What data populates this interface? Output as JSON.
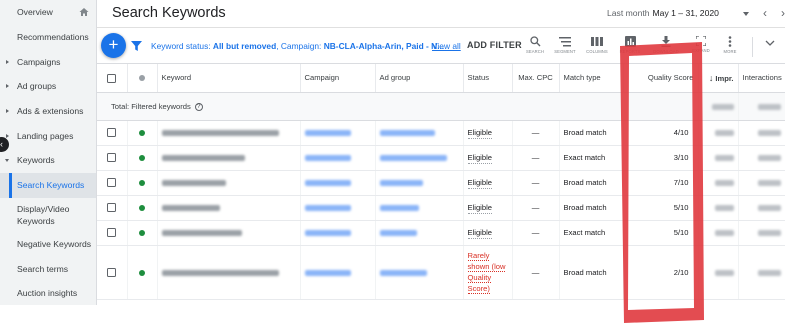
{
  "sidebar": {
    "items": [
      {
        "label": "Overview",
        "type": "top"
      },
      {
        "label": "Recommendations",
        "type": "top"
      },
      {
        "label": "Campaigns",
        "type": "caret"
      },
      {
        "label": "Ad groups",
        "type": "caret"
      },
      {
        "label": "Ads & extensions",
        "type": "caret"
      },
      {
        "label": "Landing pages",
        "type": "caret"
      },
      {
        "label": "Keywords",
        "type": "open"
      },
      {
        "label": "Search Keywords",
        "type": "active"
      },
      {
        "label": "Display/Video Keywords",
        "type": "sub"
      },
      {
        "label": "Negative Keywords",
        "type": "sub"
      },
      {
        "label": "Search terms",
        "type": "sub"
      },
      {
        "label": "Auction insights",
        "type": "sub"
      }
    ]
  },
  "header": {
    "title": "Search Keywords",
    "date_label": "Last month",
    "date_value": "May 1 – 31, 2020"
  },
  "toolbar": {
    "add_icon": "+",
    "filter_prefix": "Keyword status: ",
    "filter_status": "All but removed",
    "filter_mid": ", Campaign: ",
    "filter_campaign": "NB-CLA-Alpha-Arin, Paid - N...",
    "view_all": "View all",
    "add_filter": "ADD FILTER",
    "tools": [
      "SEARCH",
      "SEGMENT",
      "COLUMNS",
      "REPORTS",
      "DOWNLOAD",
      "EXPAND",
      "MORE"
    ]
  },
  "table": {
    "headers": {
      "keyword": "Keyword",
      "campaign": "Campaign",
      "ad_group": "Ad group",
      "status": "Status",
      "max_cpc": "Max. CPC",
      "match_type": "Match type",
      "quality_score": "Quality Score",
      "impr": "Impr.",
      "interactions": "Interactions"
    },
    "total_label": "Total: Filtered keywords",
    "rows": [
      {
        "status": "Eligible",
        "max_cpc": "—",
        "match_type": "Broad match",
        "quality_score": "4/10"
      },
      {
        "status": "Eligible",
        "max_cpc": "—",
        "match_type": "Exact match",
        "quality_score": "3/10"
      },
      {
        "status": "Eligible",
        "max_cpc": "—",
        "match_type": "Broad match",
        "quality_score": "7/10"
      },
      {
        "status": "Eligible",
        "max_cpc": "—",
        "match_type": "Broad match",
        "quality_score": "5/10"
      },
      {
        "status": "Eligible",
        "max_cpc": "—",
        "match_type": "Exact match",
        "quality_score": "5/10"
      },
      {
        "status": "Rarely shown (low Quality Score)",
        "max_cpc": "—",
        "match_type": "Broad match",
        "quality_score": "2/10",
        "warning": true
      }
    ]
  },
  "colors": {
    "accent": "#1a73e8",
    "enabled_dot": "#1e8e3e",
    "warning_text": "#d93025",
    "highlight": "#e0383e"
  }
}
